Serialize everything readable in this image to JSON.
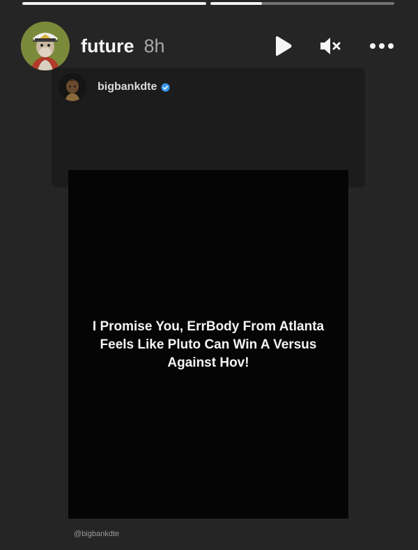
{
  "story": {
    "progress": [
      1.0,
      0.28
    ],
    "user": {
      "username": "future",
      "timestamp": "8h",
      "avatar_icon": "bored-ape-avatar-icon"
    },
    "controls": {
      "play_icon": "play-icon",
      "mute_icon": "muted-speaker-icon",
      "more_icon": "more-options-icon"
    }
  },
  "shared_post": {
    "username": "bigbankdte",
    "verified": true,
    "verified_color": "#3897f0",
    "avatar_icon": "profile-avatar-icon",
    "quote": "I Promise You, ErrBody From Atlanta Feels Like Pluto Can Win A Versus Against Hov!",
    "credit": "@bigbankdte"
  }
}
